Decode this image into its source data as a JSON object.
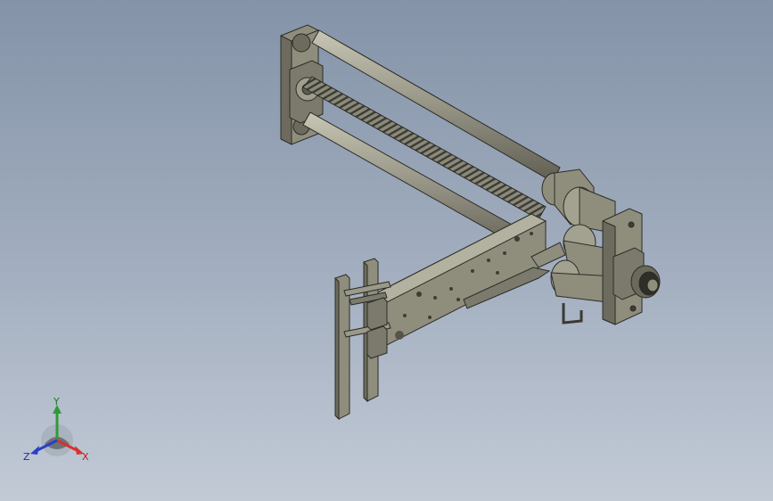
{
  "scene": {
    "part_color": "#8f8e7d",
    "part_dark": "#5d5c4f",
    "part_light": "#b3b2a0",
    "edge_color": "#2c2c26"
  },
  "triad": {
    "x_label": "X",
    "y_label": "Y",
    "z_label": "Z",
    "x_color": "#d8322e",
    "y_color": "#2f9a35",
    "z_color": "#2a3fc4"
  }
}
